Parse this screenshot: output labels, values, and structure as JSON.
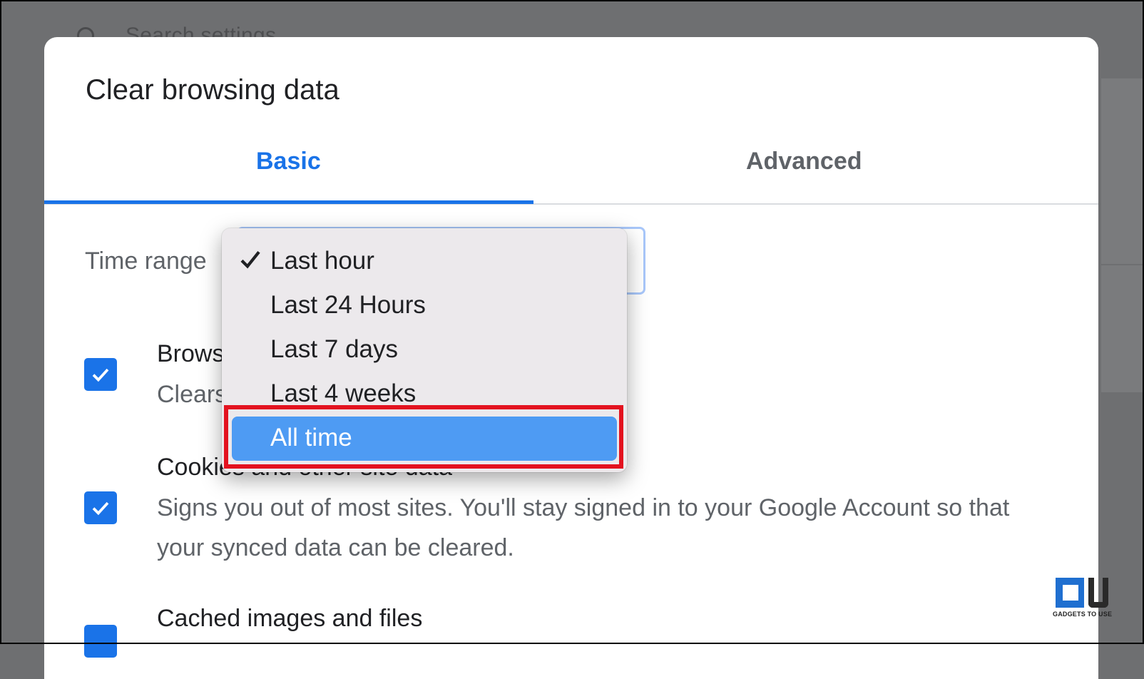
{
  "background": {
    "search_placeholder": "Search settings"
  },
  "dialog": {
    "title": "Clear browsing data",
    "tabs": [
      {
        "label": "Basic",
        "active": true
      },
      {
        "label": "Advanced",
        "active": false
      }
    ],
    "time_range_label": "Time range",
    "items": [
      {
        "title": "Brows",
        "desc": "Clears",
        "checked": true
      },
      {
        "title": "Cookies and other site data",
        "desc": "Signs you out of most sites. You'll stay signed in to your Google Account so that your synced data can be cleared.",
        "checked": true
      },
      {
        "title": "Cached images and files",
        "checked": true
      }
    ]
  },
  "dropdown": {
    "options": [
      "Last hour",
      "Last 24 Hours",
      "Last 7 days",
      "Last 4 weeks",
      "All time"
    ],
    "checked_option": "Last hour",
    "highlighted_option": "All time"
  },
  "watermark": {
    "tagline": "GADGETS TO USE"
  },
  "colors": {
    "accent": "#1a73e8",
    "highlight_border": "#e3121f",
    "menu_selection": "#4e9bf3"
  }
}
